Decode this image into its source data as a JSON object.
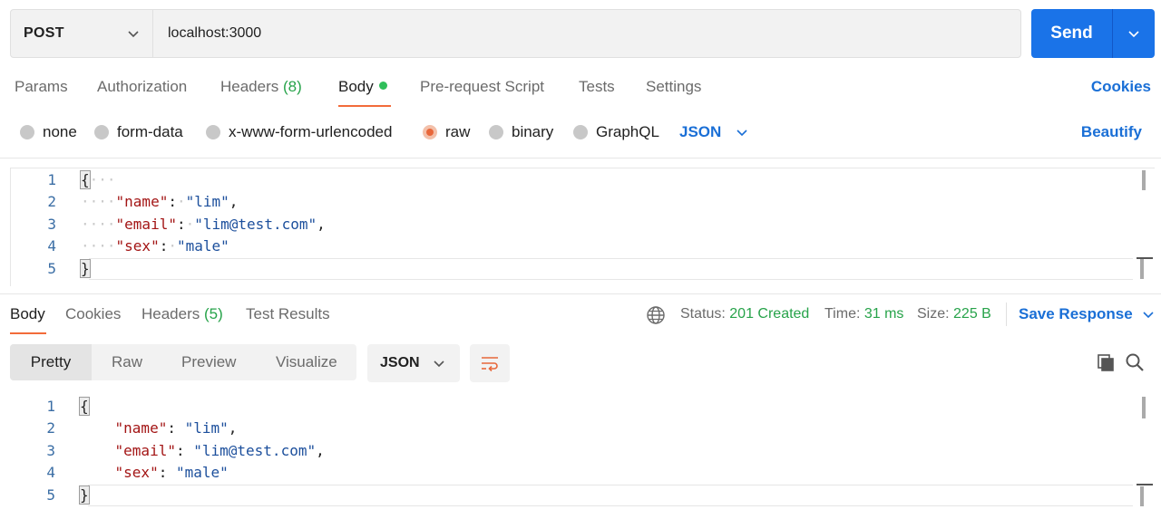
{
  "request": {
    "method": "POST",
    "url": "localhost:3000",
    "send_label": "Send"
  },
  "request_tabs": [
    {
      "label": "Params"
    },
    {
      "label": "Authorization"
    },
    {
      "label": "Headers",
      "count": "(8)"
    },
    {
      "label": "Body",
      "active": true
    },
    {
      "label": "Pre-request Script"
    },
    {
      "label": "Tests"
    },
    {
      "label": "Settings"
    }
  ],
  "cookies_label": "Cookies",
  "body_types": [
    {
      "label": "none"
    },
    {
      "label": "form-data"
    },
    {
      "label": "x-www-form-urlencoded"
    },
    {
      "label": "raw",
      "selected": true
    },
    {
      "label": "binary"
    },
    {
      "label": "GraphQL"
    }
  ],
  "raw_format": "JSON",
  "beautify_label": "Beautify",
  "request_body": {
    "line_numbers": [
      "1",
      "2",
      "3",
      "4",
      "5"
    ],
    "open_brace": "{",
    "close_brace": "}",
    "fields": [
      {
        "key": "\"name\"",
        "value": "\"lim\"",
        "sep": ","
      },
      {
        "key": "\"email\"",
        "value": "\"lim@test.com\"",
        "sep": ","
      },
      {
        "key": "\"sex\"",
        "value": "\"male\"",
        "sep": ""
      }
    ]
  },
  "response_tabs": [
    {
      "label": "Body",
      "active": true
    },
    {
      "label": "Cookies"
    },
    {
      "label": "Headers",
      "count": "(5)"
    },
    {
      "label": "Test Results"
    }
  ],
  "response_meta": {
    "status_label": "Status:",
    "status_value": "201 Created",
    "time_label": "Time:",
    "time_value": "31 ms",
    "size_label": "Size:",
    "size_value": "225 B",
    "save_label": "Save Response"
  },
  "view_modes": [
    {
      "label": "Pretty",
      "active": true
    },
    {
      "label": "Raw"
    },
    {
      "label": "Preview"
    },
    {
      "label": "Visualize"
    }
  ],
  "response_format": "JSON",
  "response_body": {
    "line_numbers": [
      "1",
      "2",
      "3",
      "4",
      "5"
    ],
    "open_brace": "{",
    "close_brace": "}",
    "fields": [
      {
        "key": "\"name\"",
        "value": "\"lim\"",
        "sep": ","
      },
      {
        "key": "\"email\"",
        "value": "\"lim@test.com\"",
        "sep": ","
      },
      {
        "key": "\"sex\"",
        "value": "\"male\"",
        "sep": ""
      }
    ]
  },
  "colors": {
    "accent": "#1a73e8",
    "tab_underline": "#f26b3a",
    "success": "#27a34a",
    "json_key": "#a31515",
    "json_string": "#1c4f9c"
  },
  "icons": [
    "chevron-down-icon",
    "globe-icon",
    "wrap-lines-icon",
    "copy-icon",
    "search-icon"
  ]
}
